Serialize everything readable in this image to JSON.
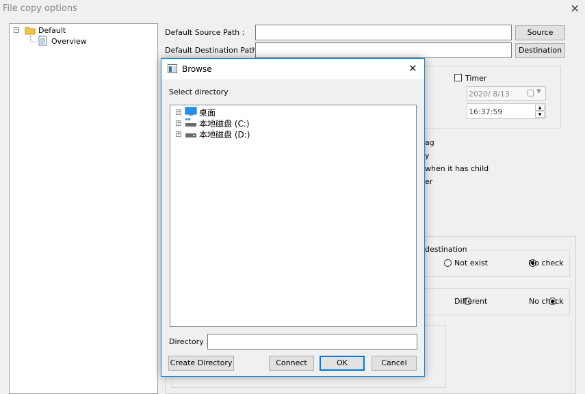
{
  "window": {
    "title": "File copy options",
    "close_glyph": "✕"
  },
  "tree": {
    "root": {
      "label": "Default",
      "expander": "−"
    },
    "children": [
      {
        "label": "Overview"
      }
    ]
  },
  "form": {
    "source_label": "Default Source Path :",
    "source_value": "",
    "source_button": "Source",
    "destination_label": "Default Destination Path :",
    "destination_value": "",
    "destination_button": "Destination",
    "timer_label": "Timer",
    "timer_checked": false,
    "date_value": "2020/  8/13",
    "time_value": "16:37:59",
    "partial_options": [
      "ag",
      "y",
      "when it has child",
      "er"
    ],
    "group1_title": "destination",
    "group1_options": [
      {
        "label": "Not exist",
        "selected": false
      },
      {
        "label": "No check",
        "selected": true
      }
    ],
    "group2_options": [
      {
        "label": "Different",
        "selected": false
      },
      {
        "label": "No check",
        "selected": true
      }
    ]
  },
  "dialog": {
    "title": "Browse",
    "close_glyph": "✕",
    "select_label": "Select directory",
    "tree_items": [
      {
        "label": "桌面",
        "icon": "desktop-icon"
      },
      {
        "label": "本地磁盘 (C:)",
        "icon": "drive-c-icon"
      },
      {
        "label": "本地磁盘 (D:)",
        "icon": "drive-d-icon"
      }
    ],
    "directory_label": "Directory :",
    "directory_value": "",
    "create_button": "Create Directory",
    "connect_button": "Connect",
    "ok_button": "OK",
    "cancel_button": "Cancel"
  },
  "colors": {
    "accent": "#0078d7",
    "dialog_border": "#1883d7"
  }
}
